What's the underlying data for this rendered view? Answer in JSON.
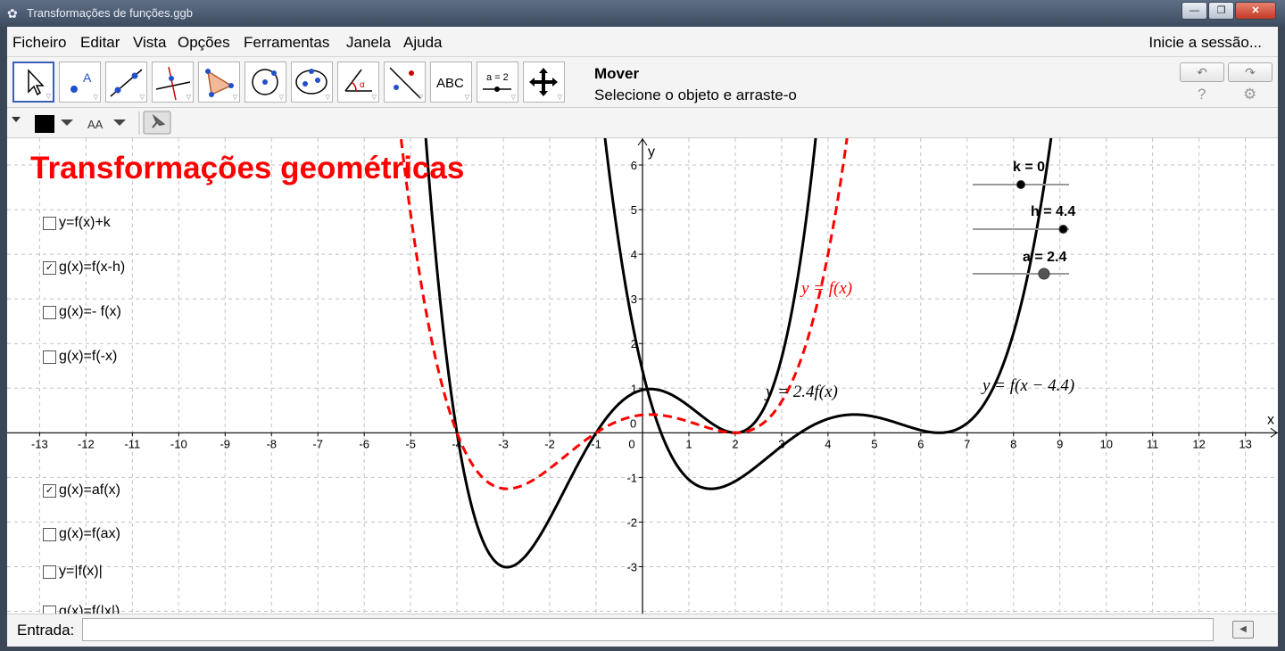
{
  "window": {
    "title": "Transformações de funções.ggb",
    "min_icon": "—",
    "max_icon": "❐",
    "close_icon": "✕"
  },
  "menu": {
    "items": [
      "Ficheiro",
      "Editar",
      "Vista",
      "Opções",
      "Ferramentas",
      "Janela",
      "Ajuda"
    ],
    "login": "Inicie a sessão..."
  },
  "toolbar": {
    "tools": [
      "move-tool",
      "point-tool",
      "line-tool",
      "perpendicular-line-tool",
      "polygon-tool",
      "circle-tool",
      "ellipse-tool",
      "angle-tool",
      "reflect-tool",
      "text-tool",
      "slider-tool",
      "move-graphics-tool"
    ],
    "text_tool_label": "ABC",
    "slider_tool_label": "a = 2",
    "active_tool_name": "Mover",
    "active_tool_help": "Selecione o objeto e arraste-o",
    "undo_icon": "↶",
    "redo_icon": "↷",
    "help_icon": "?",
    "settings_icon": "⚙"
  },
  "stylebar": {
    "color": "#000000",
    "font_size_label": "AA"
  },
  "graphics": {
    "heading": "Transformações geométricas",
    "x_axis_label": "x",
    "y_axis_label": "y",
    "x_min": -13.7,
    "x_max": 13.7,
    "y_min": -4.05,
    "y_max": 6.6,
    "x_ticks": [
      -13,
      -12,
      -11,
      -10,
      -9,
      -8,
      -7,
      -6,
      -5,
      -4,
      -3,
      -2,
      -1,
      0,
      1,
      2,
      3,
      4,
      5,
      6,
      7,
      8,
      9,
      10,
      11,
      12,
      13
    ],
    "y_ticks": [
      6,
      5,
      4,
      3,
      2,
      1,
      -1,
      -2,
      -3
    ],
    "checkboxes_top": [
      {
        "label": "y=f(x)+k",
        "checked": false
      },
      {
        "label": "g(x)=f(x-h)",
        "checked": true
      },
      {
        "label": "g(x)=- f(x)",
        "checked": false
      },
      {
        "label": "g(x)=f(-x)",
        "checked": false
      }
    ],
    "checkboxes_bottom": [
      {
        "label": "g(x)=af(x)",
        "checked": true
      },
      {
        "label": "g(x)=f(ax)",
        "checked": false
      },
      {
        "label": "y=|f(x)|",
        "checked": false
      },
      {
        "label": "g(x)=f(|x|)",
        "checked": false
      }
    ],
    "sliders": [
      {
        "label": "k = 0",
        "value": 0,
        "min": -5,
        "max": 5
      },
      {
        "label": "h = 4.4",
        "value": 4.4,
        "min": -5,
        "max": 5
      },
      {
        "label": "a = 2.4",
        "value": 2.4,
        "min": -5,
        "max": 5
      }
    ],
    "curve_labels": {
      "f": "y = f(x)",
      "af": "y = 2.4f(x)",
      "shift": "y = f(x − 4.4)"
    },
    "colors": {
      "f": "#ff0000",
      "transformed": "#000000",
      "heading": "#ff0000",
      "grid": "#c0c0c0"
    }
  },
  "input": {
    "label": "Entrada:",
    "value": "",
    "keyboard_icon": "keyboard-icon"
  }
}
